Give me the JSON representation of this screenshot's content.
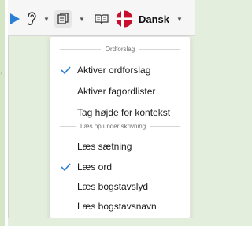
{
  "toolbar": {
    "play_icon": "play-icon",
    "hearing_icon": "ear-icon",
    "copy_icon": "copy-icon",
    "dictionary_icon": "book-icon",
    "language": {
      "flag": "danish-flag",
      "label": "Dansk"
    },
    "colors": {
      "play": "#2a7fd4",
      "flag_red": "#c8102e"
    }
  },
  "menu": {
    "sections": [
      {
        "title": "Ordforslag",
        "items": [
          {
            "label": "Aktiver ordforslag",
            "checked": true
          },
          {
            "label": "Aktiver fagordlister",
            "checked": false
          },
          {
            "label": "Tag højde for kontekst",
            "checked": false
          }
        ]
      },
      {
        "title": "Læs op under skrivning",
        "items": [
          {
            "label": "Læs sætning",
            "checked": false
          },
          {
            "label": "Læs ord",
            "checked": true
          },
          {
            "label": "Læs bogstavslyd",
            "checked": false
          },
          {
            "label": "Læs bogstavsnavn",
            "checked": false
          }
        ]
      }
    ],
    "check_color": "#2a7fd4"
  }
}
